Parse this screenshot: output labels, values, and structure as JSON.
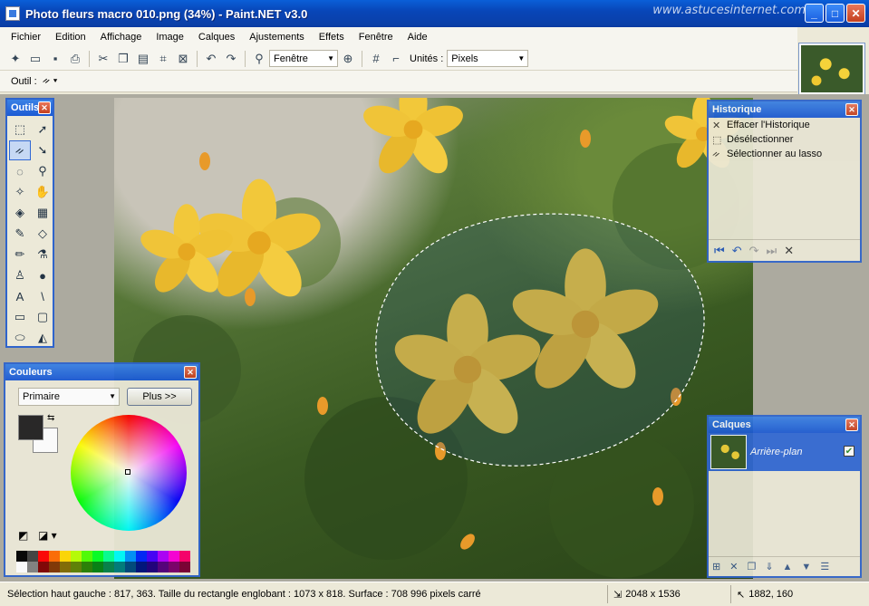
{
  "window": {
    "title": "Photo fleurs macro 010.png (34%) - Paint.NET v3.0",
    "watermark": "www.astucesinternet.com",
    "minimize": "_",
    "maximize": "□",
    "close": "✕"
  },
  "menubar": {
    "items": [
      "Fichier",
      "Edition",
      "Affichage",
      "Image",
      "Calques",
      "Ajustements",
      "Effets",
      "Fenêtre",
      "Aide"
    ]
  },
  "toolbar": {
    "zoom_value": "Fenêtre",
    "units_label": "Unités :",
    "units_value": "Pixels"
  },
  "toolrow": {
    "tool_label": "Outil :"
  },
  "tools_panel": {
    "title": "Outils"
  },
  "history_panel": {
    "title": "Historique",
    "items": [
      "Effacer l'Historique",
      "Désélectionner",
      "Sélectionner au lasso"
    ]
  },
  "colors_panel": {
    "title": "Couleurs",
    "mode": "Primaire",
    "more_button": "Plus >>",
    "primary_color": "#222222",
    "secondary_color": "#ffffff",
    "palette": [
      "#000000",
      "#404040",
      "#ff0000",
      "#ff6a00",
      "#ffd800",
      "#b6ff00",
      "#4cff00",
      "#00ff21",
      "#00ff90",
      "#00ffff",
      "#0094ff",
      "#0026ff",
      "#4800ff",
      "#b200ff",
      "#ff00dc",
      "#ff006e",
      "#ffffff",
      "#808080",
      "#7f0000",
      "#7f3300",
      "#7f6a00",
      "#5b7f00",
      "#267f00",
      "#007f0e",
      "#007f46",
      "#007f7f",
      "#004a7f",
      "#00137f",
      "#21007f",
      "#57007f",
      "#7f006e",
      "#7f0037"
    ]
  },
  "layers_panel": {
    "title": "Calques",
    "layers": [
      {
        "name": "Arrière-plan",
        "visible": true
      }
    ]
  },
  "statusbar": {
    "selection_info": "Sélection haut gauche : 817, 363. Taille du rectangle englobant : 1073 x 818. Surface : 708 996 pixels carré",
    "image_size": "2048 x 1536",
    "cursor_position": "1882, 160"
  },
  "colors": {
    "accent": "#0a5fd8",
    "panel_title": "#1c5ad4",
    "selected_layer": "#3168d5"
  }
}
